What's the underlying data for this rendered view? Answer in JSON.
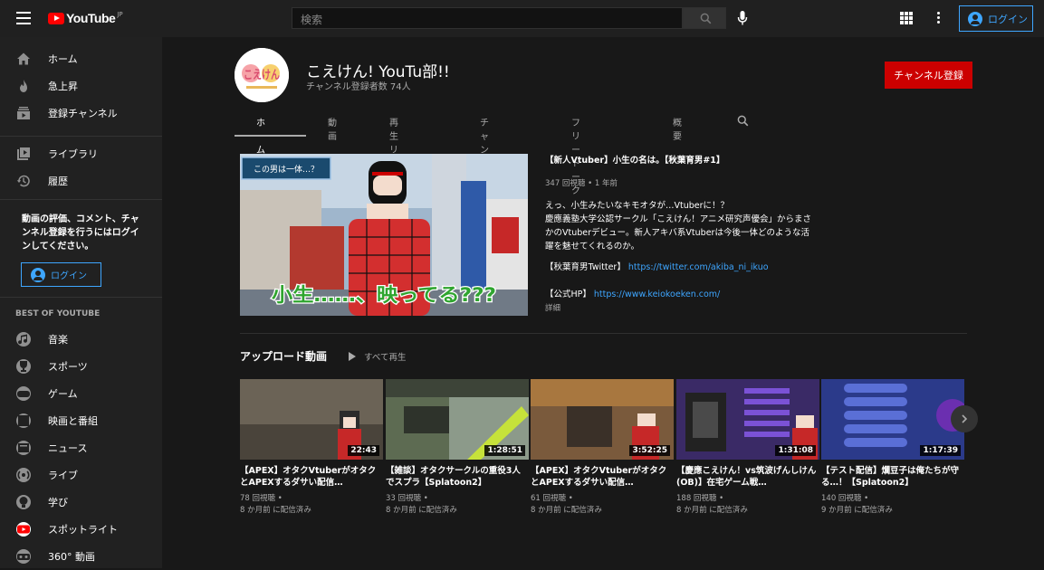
{
  "topbar": {
    "logo_text": "YouTube",
    "logo_region": "JP",
    "search_placeholder": "検索",
    "login_label": "ログイン"
  },
  "sidebar": {
    "main_items": [
      {
        "label": "ホーム",
        "icon": "home-icon"
      },
      {
        "label": "急上昇",
        "icon": "flame-icon"
      },
      {
        "label": "登録チャンネル",
        "icon": "subscriptions-icon"
      }
    ],
    "library_items": [
      {
        "label": "ライブラリ",
        "icon": "library-icon"
      },
      {
        "label": "履歴",
        "icon": "history-icon"
      }
    ],
    "note": "動画の評価、コメント、チャンネル登録を行うにはログインしてください。",
    "login_label": "ログイン",
    "best_heading": "BEST OF YOUTUBE",
    "best_items": [
      {
        "label": "音楽",
        "icon": "music-icon"
      },
      {
        "label": "スポーツ",
        "icon": "trophy-icon"
      },
      {
        "label": "ゲーム",
        "icon": "gamepad-icon"
      },
      {
        "label": "映画と番組",
        "icon": "film-icon"
      },
      {
        "label": "ニュース",
        "icon": "news-icon"
      },
      {
        "label": "ライブ",
        "icon": "live-icon"
      },
      {
        "label": "学び",
        "icon": "bulb-icon"
      },
      {
        "label": "スポットライト",
        "icon": "youtube-spotlight-icon"
      },
      {
        "label": "360° 動画",
        "icon": "vr-icon"
      }
    ]
  },
  "channel": {
    "name": "こえけん! YouTu部!!",
    "subscribers": "チャンネル登録者数 74人",
    "subscribe_label": "チャンネル登録",
    "avatar_text": "こえけん",
    "tabs": [
      "ホーム",
      "動画",
      "再生リスト",
      "チャンネル",
      "フリートーク",
      "概要"
    ]
  },
  "featured": {
    "title": "【新人Vtuber】小生の名は。【秋葉育男#1】",
    "meta": "347 回視聴 • 1 年前",
    "desc_line1": "えっ、小生みたいなキモオタが…Vtuberに！？",
    "desc_line2": "慶應義塾大学公認サークル「こえけん！アニメ研究声優会」からまさかのVtuberデビュー。新人アキバ系Vtuberは今後一体どのような活躍を魅せてくれるのか。",
    "twitter_label": "【秋葉育男Twitter】",
    "twitter_url": "https://twitter.com/akiba_ni_ikuo",
    "hp_label": "【公式HP】",
    "hp_url": "https://www.keiokoeken.com/",
    "more": "詳細",
    "thumb_caption": "小生……、映ってる???",
    "thumb_tag": "この男は一体…？"
  },
  "uploads": {
    "title": "アップロード動画",
    "play_all": "すべて再生",
    "videos": [
      {
        "title": "【APEX】オタクVtuberがオタクとAPEXするダサい配信…",
        "views": "78 回視聴 •",
        "age": "8 か月前 に配信済み",
        "duration": "22:43",
        "color": "#6b6356"
      },
      {
        "title": "【雑談】オタクサークルの重役3人でスプラ【Splatoon2】",
        "views": "33 回視聴 •",
        "age": "8 か月前 に配信済み",
        "duration": "1:28:51",
        "color": "#5d6b52"
      },
      {
        "title": "【APEX】オタクVtuberがオタクとAPEXするダサい配信…",
        "views": "61 回視聴 •",
        "age": "8 か月前 に配信済み",
        "duration": "3:52:25",
        "color": "#7a5a3c"
      },
      {
        "title": "【慶應こえけん！vs筑波げんしけん(OB)】在宅ゲーム戦…",
        "views": "188 回視聴 •",
        "age": "8 か月前 に配信済み",
        "duration": "1:31:08",
        "color": "#3a2a66"
      },
      {
        "title": "【テスト配信】爛豆子は俺たちが守る…！【Splatoon2】",
        "views": "140 回視聴 •",
        "age": "9 か月前 に配信済み",
        "duration": "1:17:39",
        "color": "#2b3a8a"
      }
    ]
  }
}
